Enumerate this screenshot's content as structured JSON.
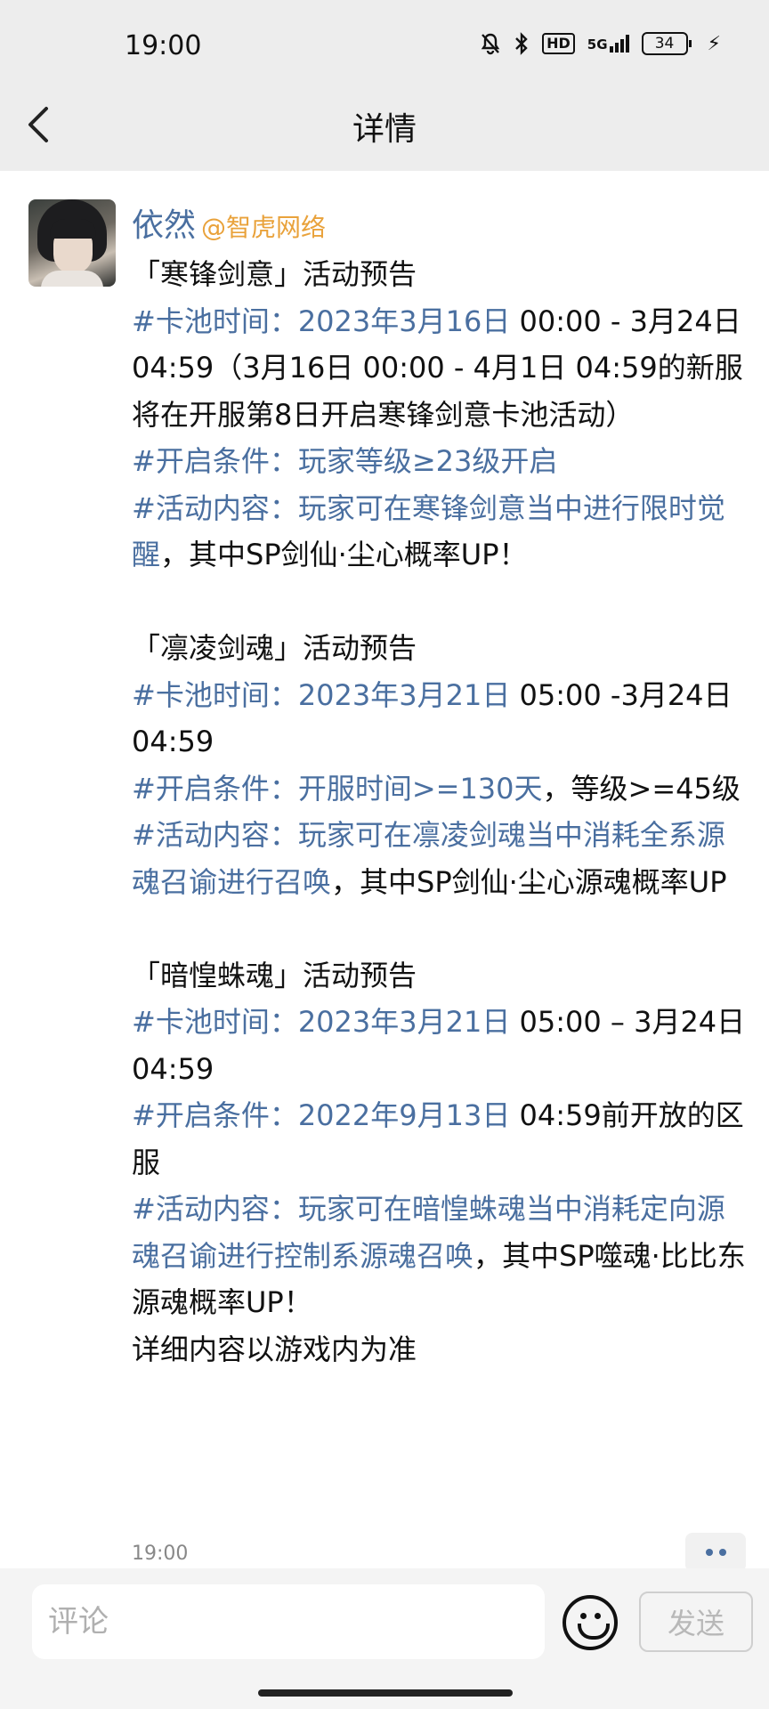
{
  "status_bar": {
    "time": "19:00",
    "icons": [
      "mute-icon",
      "bluetooth-icon",
      "hd-icon",
      "signal-5g-icon",
      "battery-icon",
      "charging-icon"
    ],
    "hd": "HD",
    "network": "5G",
    "battery": "34"
  },
  "header": {
    "title": "详情",
    "back_icon": "chevron-left-icon"
  },
  "post": {
    "author": "依然",
    "handle": "@智虎网络",
    "sections": [
      {
        "title": "「寒锋剑意」活动预告",
        "lines": [
          {
            "blue": "#卡池时间：2023年3月16日",
            "black": " 00:00 - 3月24日 04:59（3月16日 00:00 - 4月1日 04:59的新服将在开服第8日开启寒锋剑意卡池活动）"
          },
          {
            "blue": "#开启条件：玩家等级≥23级开启",
            "black": ""
          },
          {
            "blue": "#活动内容：玩家可在寒锋剑意当中进行限时觉醒",
            "black": "，其中SP剑仙·尘心概率UP！"
          }
        ]
      },
      {
        "title": "「凛凌剑魂」活动预告",
        "lines": [
          {
            "blue": "#卡池时间：2023年3月21日",
            "black": " 05:00 -3月24日 04:59"
          },
          {
            "blue": "#开启条件：开服时间>=130天",
            "black": "，等级>=45级"
          },
          {
            "blue": "#活动内容：玩家可在凛凌剑魂当中消耗全系源魂召谕进行召唤",
            "black": "，其中SP剑仙·尘心源魂概率UP"
          }
        ]
      },
      {
        "title": "「暗惶蛛魂」活动预告",
        "lines": [
          {
            "blue": "#卡池时间：2023年3月21日",
            "black": " 05:00 – 3月24日 04:59"
          },
          {
            "blue": "#开启条件：2022年9月13日",
            "black": " 04:59前开放的区服"
          },
          {
            "blue": "#活动内容：玩家可在暗惶蛛魂当中消耗定向源魂召谕进行控制系源魂召唤",
            "black": "，其中SP噬魂·比比东源魂概率UP！"
          }
        ]
      }
    ],
    "footer_note": "详细内容以游戏内为准",
    "time": "19:00",
    "more_icon": "more-dots-icon"
  },
  "comment_bar": {
    "placeholder": "评论",
    "emoji_icon": "emoji-icon",
    "send_label": "发送"
  },
  "colors": {
    "link_blue": "#4a6fa0",
    "handle_orange": "#e9a23b",
    "header_bg": "#ededed"
  }
}
